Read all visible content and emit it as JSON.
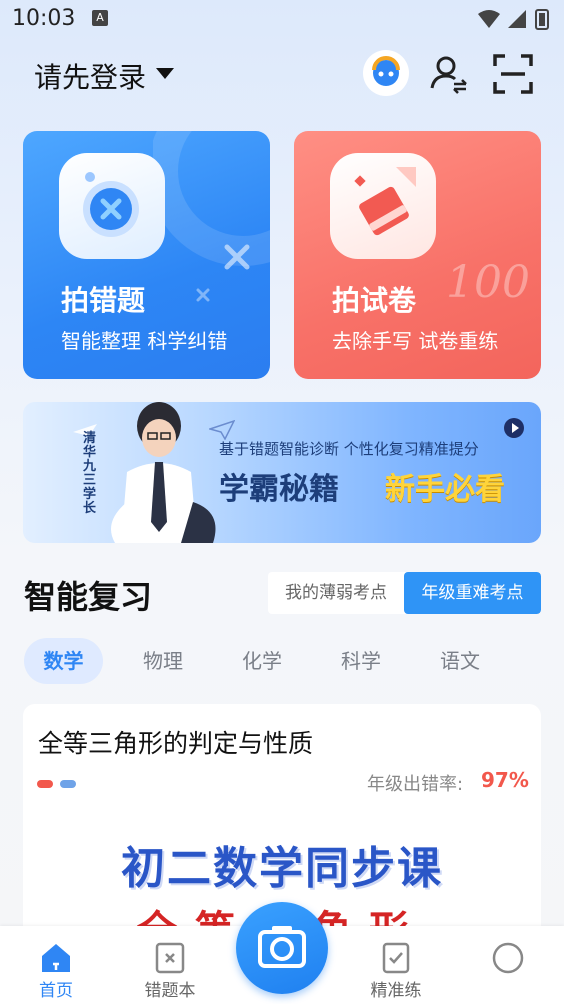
{
  "status_bar": {
    "time": "10:03",
    "a_badge": "A"
  },
  "header": {
    "login_text": "请先登录"
  },
  "cards": [
    {
      "title": "拍错题",
      "subtitle": "智能整理 科学纠错"
    },
    {
      "title": "拍试卷",
      "subtitle": "去除手写 试卷重练",
      "deco_text": "100"
    }
  ],
  "banner": {
    "subtitle": "基于错题智能诊断 个性化复习精准提分",
    "title_part1": "学霸秘籍",
    "title_part2": "新手必看",
    "vertical_text": "清华九三学长"
  },
  "review": {
    "title": "智能复习",
    "toggle": {
      "weak": "我的薄弱考点",
      "hard": "年级重难考点"
    },
    "subjects": [
      "数学",
      "物理",
      "化学",
      "科学",
      "语文"
    ],
    "active_subject": "数学"
  },
  "lesson": {
    "title": "全等三角形的判定与性质",
    "error_rate_label": "年级出错率:",
    "error_rate_value": "97%",
    "cover_title": "初二数学同步课",
    "cover_sub": "全等三角形"
  },
  "bottom_nav": {
    "items": [
      {
        "label": "首页"
      },
      {
        "label": "错题本"
      },
      {
        "label": "精准练"
      }
    ]
  },
  "colors": {
    "accent": "#2f86f4",
    "blue_card": "#2d86f5",
    "red_card": "#f87168",
    "error_rate": "#f2584c"
  }
}
